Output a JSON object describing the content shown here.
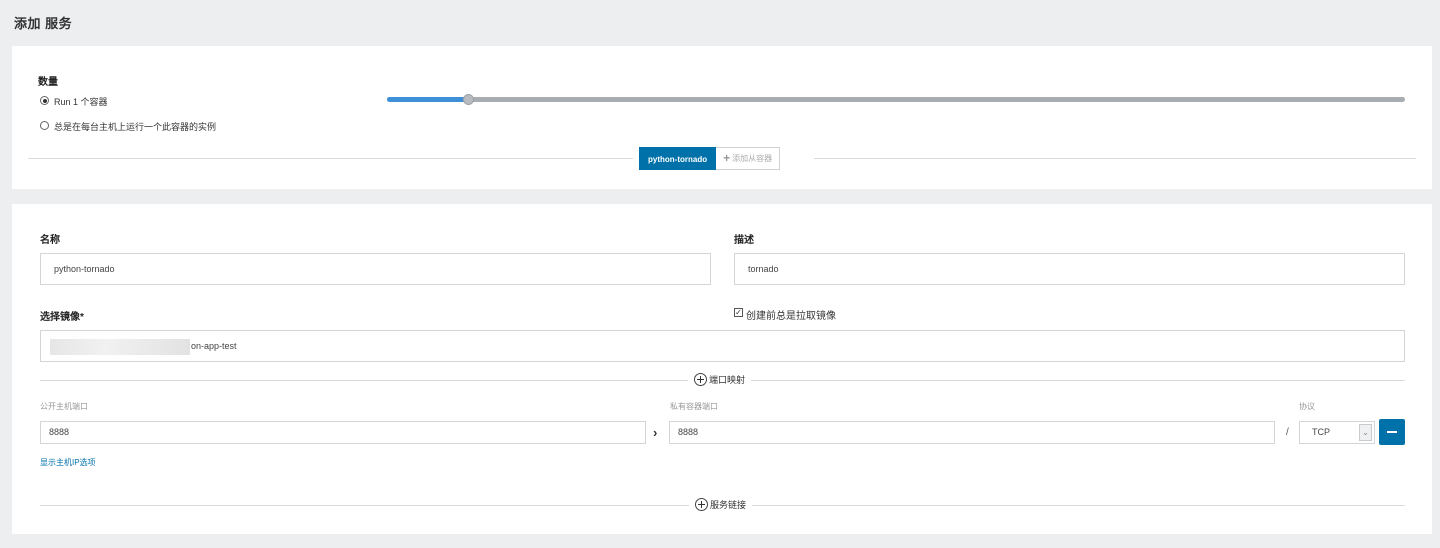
{
  "header": {
    "title": "添加 服务"
  },
  "scale": {
    "heading": "数量",
    "option_run_label": "Run 1 个容器",
    "option_global_label": "总是在每台主机上运行一个此容器的实例",
    "slider_value_fraction": 0.08
  },
  "container_tabs": {
    "active_label": "python-tornado",
    "add_label": "添加从容器"
  },
  "form": {
    "name_label": "名称",
    "name_value": "python-tornado",
    "description_label": "描述",
    "description_value": "tornado",
    "image_label": "选择镜像*",
    "image_value_visible": "on-app-test",
    "pull_checkbox_label": "创建前总是拉取镜像",
    "pull_checkbox_checked": true
  },
  "ports": {
    "section_label": "端口映射",
    "public_port_label": "公开主机端口",
    "private_port_label": "私有容器端口",
    "protocol_label": "协议",
    "public_port_value": "8888",
    "private_port_value": "8888",
    "separator": "/",
    "protocol_value": "TCP",
    "show_ip_link": "显示主机IP选项"
  },
  "links": {
    "section_label": "服务链接"
  },
  "colors": {
    "accent": "#0071a9",
    "slider_fill": "#3d8fd8"
  }
}
